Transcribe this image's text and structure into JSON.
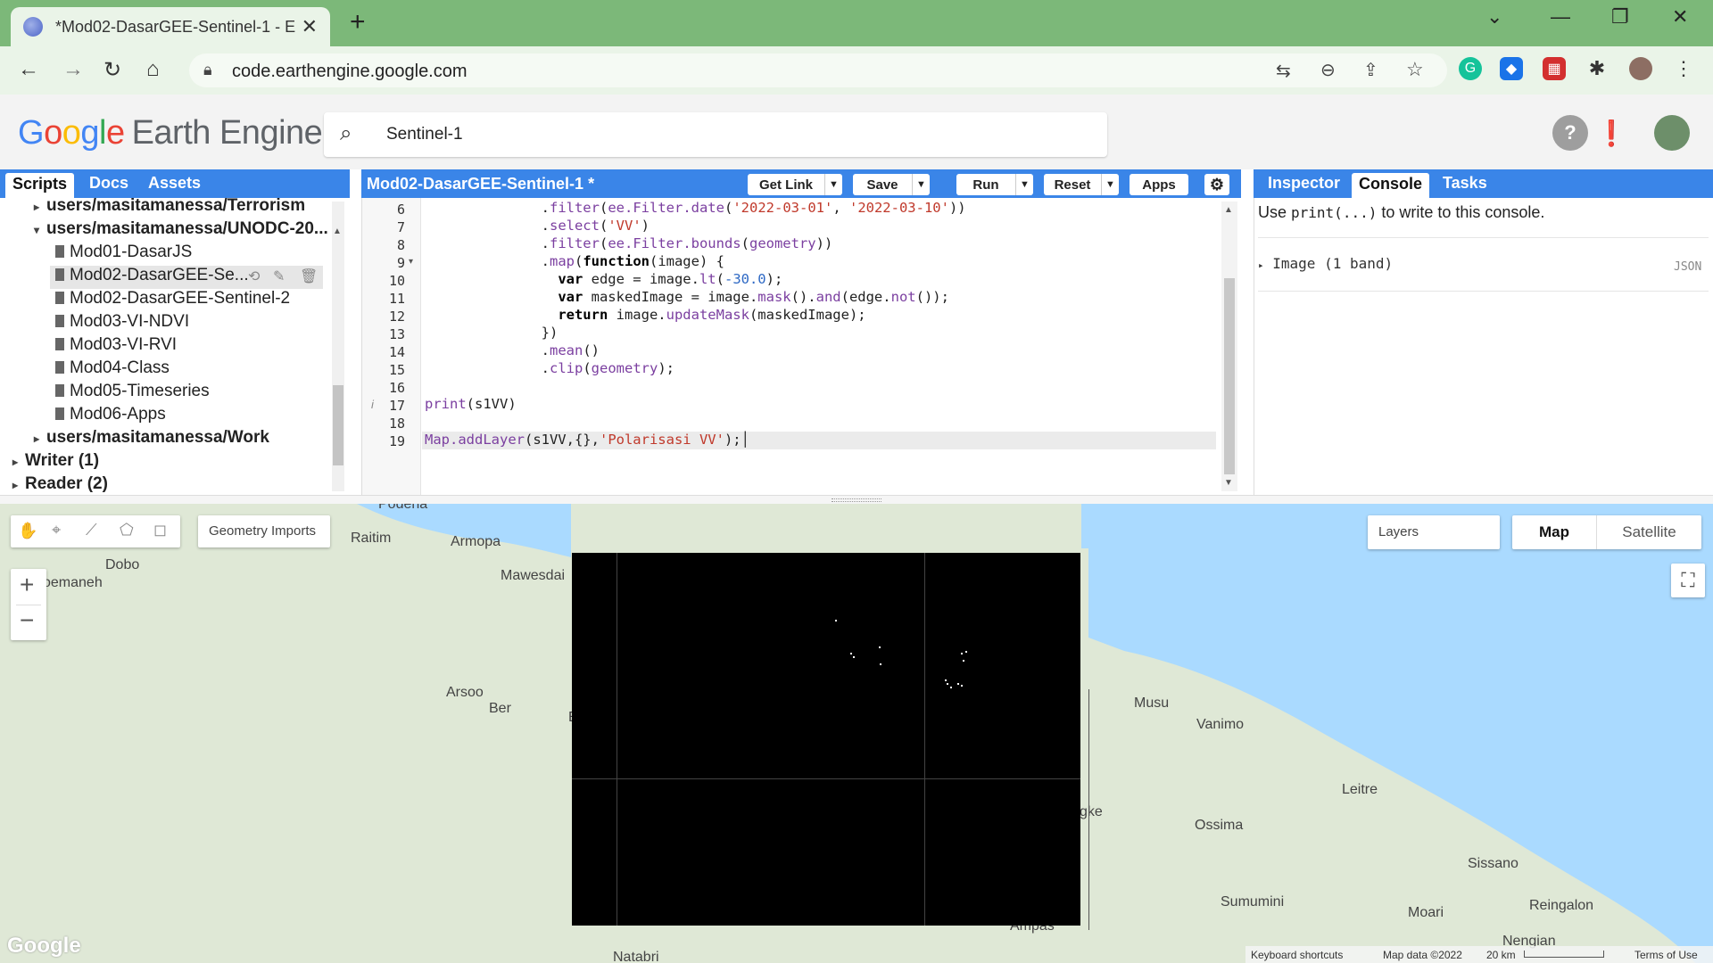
{
  "browser": {
    "tab_title": "*Mod02-DasarGEE-Sentinel-1 - E",
    "url": "code.earthengine.google.com"
  },
  "gee": {
    "logo_g": [
      "G",
      "o",
      "o",
      "g",
      "l",
      "e"
    ],
    "logo_rest": "Earth Engine",
    "search_value": "Sentinel-1"
  },
  "left_panel": {
    "tabs": [
      "Scripts",
      "Docs",
      "Assets"
    ],
    "tree": [
      {
        "label": "users/masitamanessa/Terrorism",
        "indent": 1,
        "type": "folder",
        "expanded": false
      },
      {
        "label": "users/masitamanessa/UNODC-20...",
        "indent": 1,
        "type": "folder",
        "expanded": true
      },
      {
        "label": "Mod01-DasarJS",
        "indent": 2,
        "type": "file"
      },
      {
        "label": "Mod02-DasarGEE-Se...",
        "indent": 2,
        "type": "file",
        "selected": true
      },
      {
        "label": "Mod02-DasarGEE-Sentinel-2",
        "indent": 2,
        "type": "file"
      },
      {
        "label": "Mod03-VI-NDVI",
        "indent": 2,
        "type": "file"
      },
      {
        "label": "Mod03-VI-RVI",
        "indent": 2,
        "type": "file"
      },
      {
        "label": "Mod04-Class",
        "indent": 2,
        "type": "file"
      },
      {
        "label": "Mod05-Timeseries",
        "indent": 2,
        "type": "file"
      },
      {
        "label": "Mod06-Apps",
        "indent": 2,
        "type": "file"
      },
      {
        "label": "users/masitamanessa/Work",
        "indent": 1,
        "type": "folder",
        "expanded": false
      },
      {
        "label": "Writer (1)",
        "indent": 0,
        "type": "folder",
        "expanded": false
      },
      {
        "label": "Reader (2)",
        "indent": 0,
        "type": "folder",
        "expanded": false
      }
    ]
  },
  "editor": {
    "script_title": "Mod02-DasarGEE-Sentinel-1 *",
    "buttons": {
      "get_link": "Get Link",
      "save": "Save",
      "run": "Run",
      "reset": "Reset",
      "apps": "Apps"
    },
    "line_numbers": [
      "6",
      "7",
      "8",
      "9",
      "10",
      "11",
      "12",
      "13",
      "14",
      "15",
      "16",
      "17",
      "18",
      "19"
    ]
  },
  "right_panel": {
    "tabs": [
      "Inspector",
      "Console",
      "Tasks"
    ],
    "console_hint_pre": "Use ",
    "console_hint_code": "print(...)",
    "console_hint_post": " to write to this console.",
    "console_item": "Image (1 band)",
    "console_item_link": "JSON"
  },
  "map": {
    "geometry_imports": "Geometry Imports",
    "layers": "Layers",
    "map_btn": "Map",
    "satellite_btn": "Satellite",
    "zoom_in": "+",
    "zoom_out": "−",
    "labels": [
      "Podena",
      "Raitim",
      "Armopa",
      "Dobo",
      "oemaneh",
      "Mawesdai",
      "Arsoo",
      "Ber",
      "Musu",
      "Vanimo",
      "Leitre",
      "Ossima",
      "Sissano",
      "Sumumini",
      "Moari",
      "Reingalon",
      "Nengian",
      "gke",
      "Ampas",
      "Natabri",
      "E"
    ],
    "google": "Google",
    "footer_keyboard": "Keyboard shortcuts",
    "footer_mapdata": "Map data ©2022",
    "footer_scale": "20 km",
    "footer_terms": "Terms of Use"
  }
}
